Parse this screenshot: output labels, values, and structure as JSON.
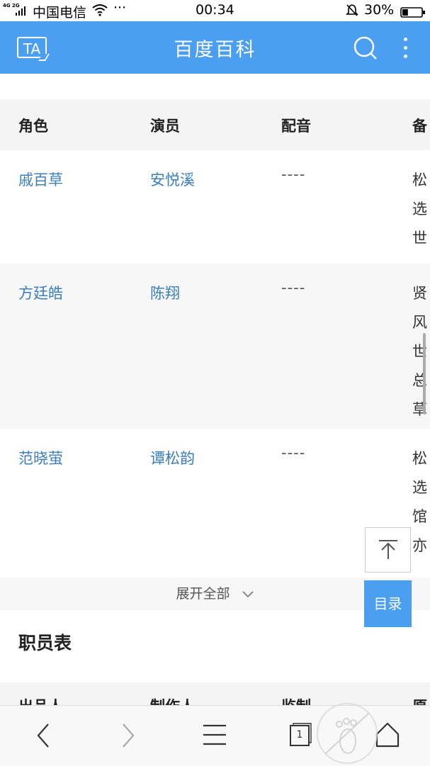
{
  "status_bar": {
    "network_badge": "4G 2G",
    "carrier": "中国电信",
    "more_dots": "···",
    "time": "00:34",
    "battery_percent": "30%",
    "battery_level": 0.3
  },
  "app_bar": {
    "ta_label": "TA",
    "title": "百度百科",
    "search_icon": "search-icon",
    "more_icon": "more-vertical-icon"
  },
  "cast_table": {
    "headers": [
      "角色",
      "演员",
      "配音",
      "备"
    ],
    "rows": [
      {
        "role": "戚百草",
        "actor": "安悦溪",
        "voice": "----",
        "note": [
          "松",
          "选",
          "世"
        ]
      },
      {
        "role": "方廷皓",
        "actor": "陈翔",
        "voice": "----",
        "note": [
          "贤",
          "风",
          "世",
          "总",
          "草"
        ]
      },
      {
        "role": "范晓萤",
        "actor": "谭松韵",
        "voice": "----",
        "note": [
          "松",
          "选",
          "馆",
          "亦"
        ]
      }
    ]
  },
  "expand_label": "展开全部",
  "expand_icon": "chevron-down-icon",
  "staff_section": {
    "title": "职员表",
    "headers": [
      "出品人",
      "制作人",
      "监制",
      "原"
    ]
  },
  "floating": {
    "back_to_top_icon": "arrow-up-icon",
    "toc_label": "目录"
  },
  "bottom_bar": {
    "back_icon": "chevron-left-icon",
    "forward_icon": "chevron-right-icon",
    "menu_icon": "menu-icon",
    "tabs_count": "1",
    "home_icon": "home-icon"
  },
  "colors": {
    "accent": "#4a9ff0",
    "link": "#3a7ebf"
  }
}
